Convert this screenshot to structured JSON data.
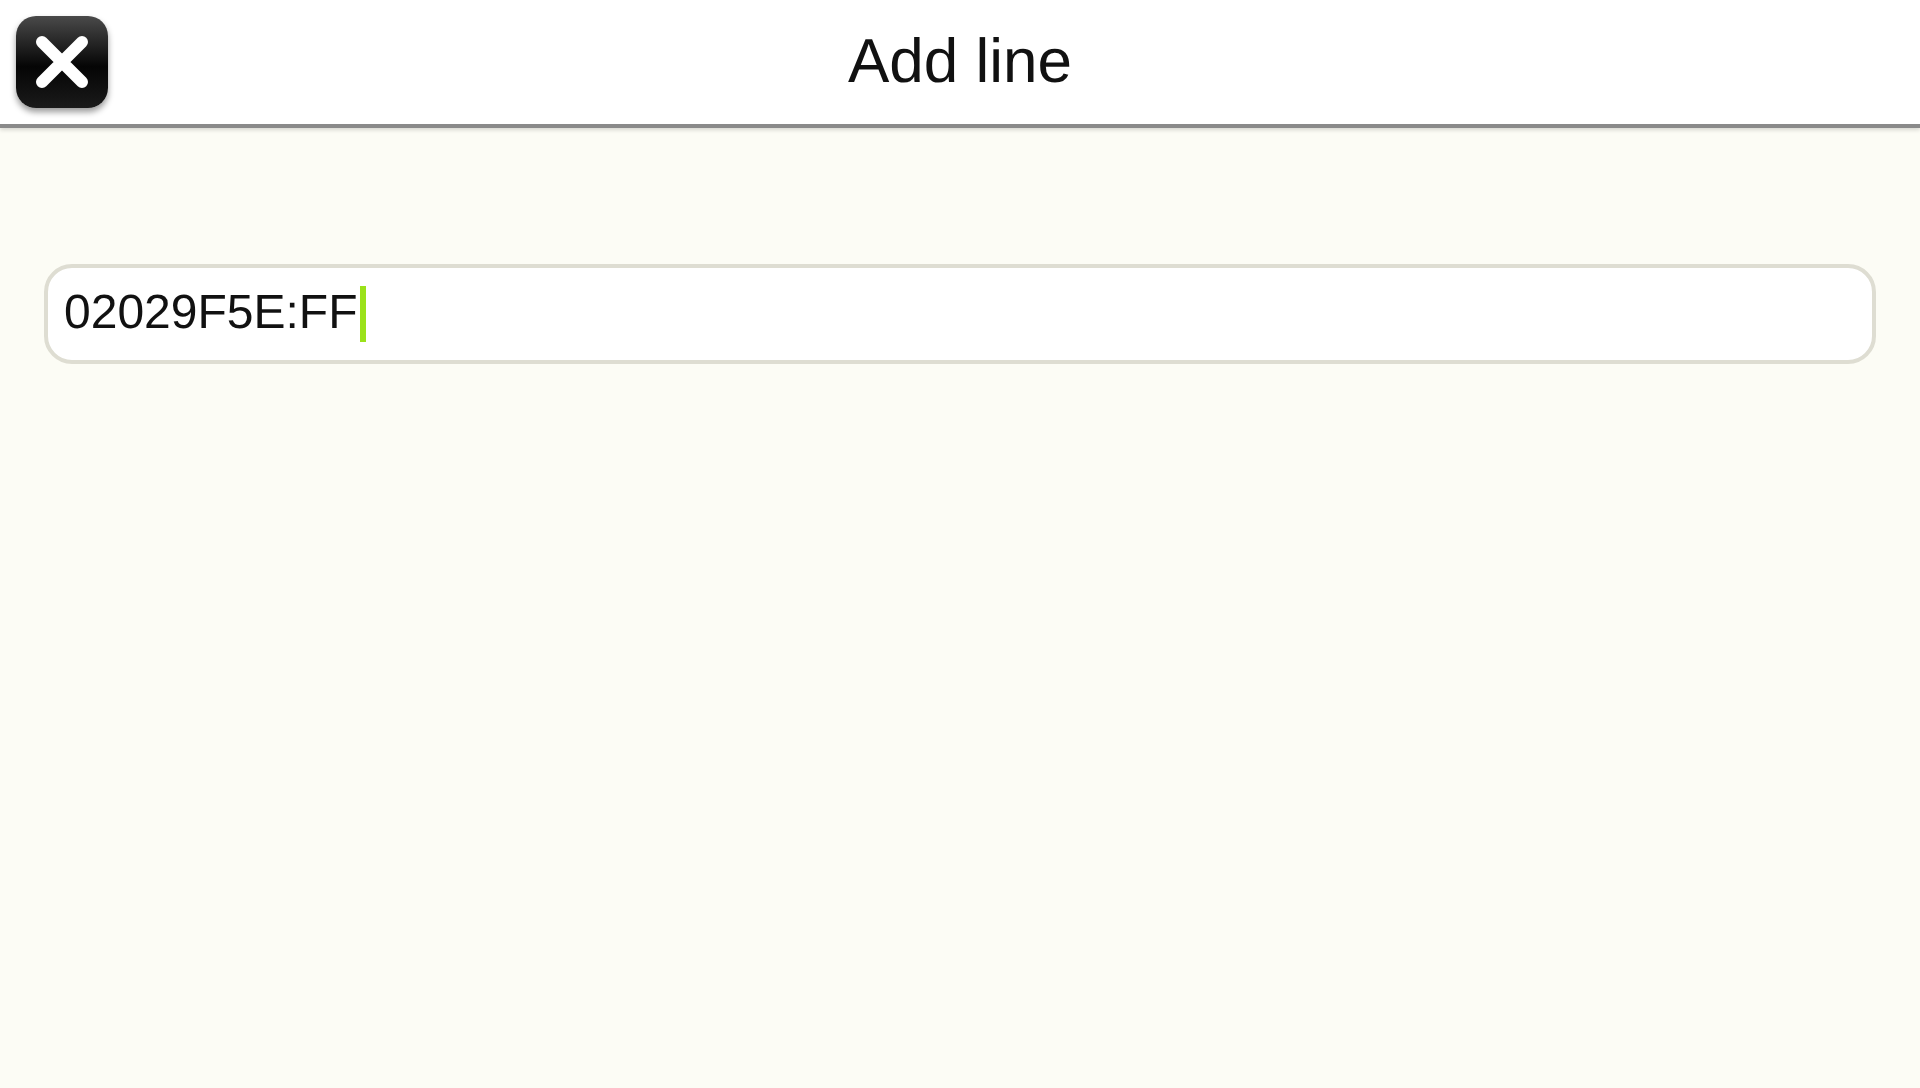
{
  "header": {
    "title": "Add line",
    "close_button": true
  },
  "field": {
    "value": "02029F5E:FF",
    "focused": true
  }
}
